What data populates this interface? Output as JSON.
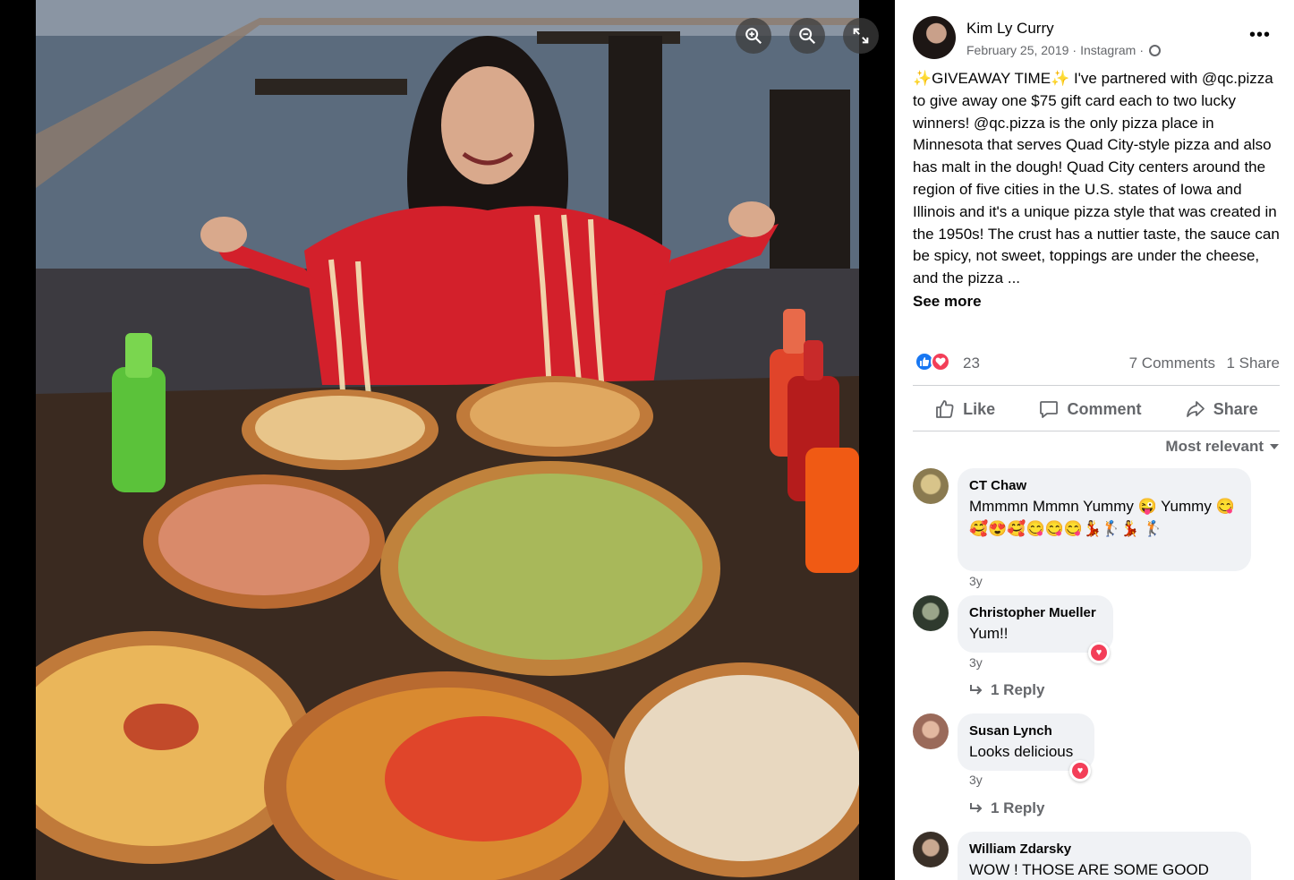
{
  "viewer": {
    "zoom_in_icon": "zoom-in-icon",
    "zoom_out_icon": "zoom-out-icon",
    "fullscreen_icon": "expand-icon"
  },
  "post": {
    "author": "Kim Ly Curry",
    "date": "February 25, 2019",
    "source": "Instagram",
    "separator": "·",
    "text_prefix": "GIVEAWAY TIME",
    "text": " I've partnered with @qc.pizza to give away one $75 gift card each to two lucky winners! @qc.pizza is the only pizza place in Minnesota that serves Quad City-style pizza and also has malt in the dough! Quad City centers around the region of five cities in the U.S. states of Iowa and Illinois and it's a unique pizza style that was created in the 1950s! The crust has a nuttier taste, the sauce can be spicy, not sweet, toppings are under the cheese, and the pizza ...",
    "see_more": "See more",
    "reaction_count": "23",
    "comment_count": "7 Comments",
    "share_count": "1 Share"
  },
  "actions": {
    "like": "Like",
    "comment": "Comment",
    "share": "Share"
  },
  "sort_label": "Most relevant",
  "comments": [
    {
      "name": "CT Chaw",
      "text": "Mmmmn Mmmn Yummy 😜 Yummy 😋 🥰😍🥰😋😋😋💃🏌️💃 🏌️",
      "time": "3y"
    },
    {
      "name": "Christopher Mueller",
      "text": "Yum!!",
      "time": "3y",
      "reply": "1 Reply"
    },
    {
      "name": "Susan Lynch",
      "text": "Looks delicious",
      "time": "3y",
      "reply": "1 Reply"
    },
    {
      "name": "William Zdarsky",
      "text": "WOW ! THOSE ARE SOME GOOD"
    }
  ],
  "colors": {
    "like_blue": "#1877f2",
    "love_red": "#f33e58",
    "secondary_text": "#65676b",
    "bubble_bg": "#f0f2f5"
  }
}
